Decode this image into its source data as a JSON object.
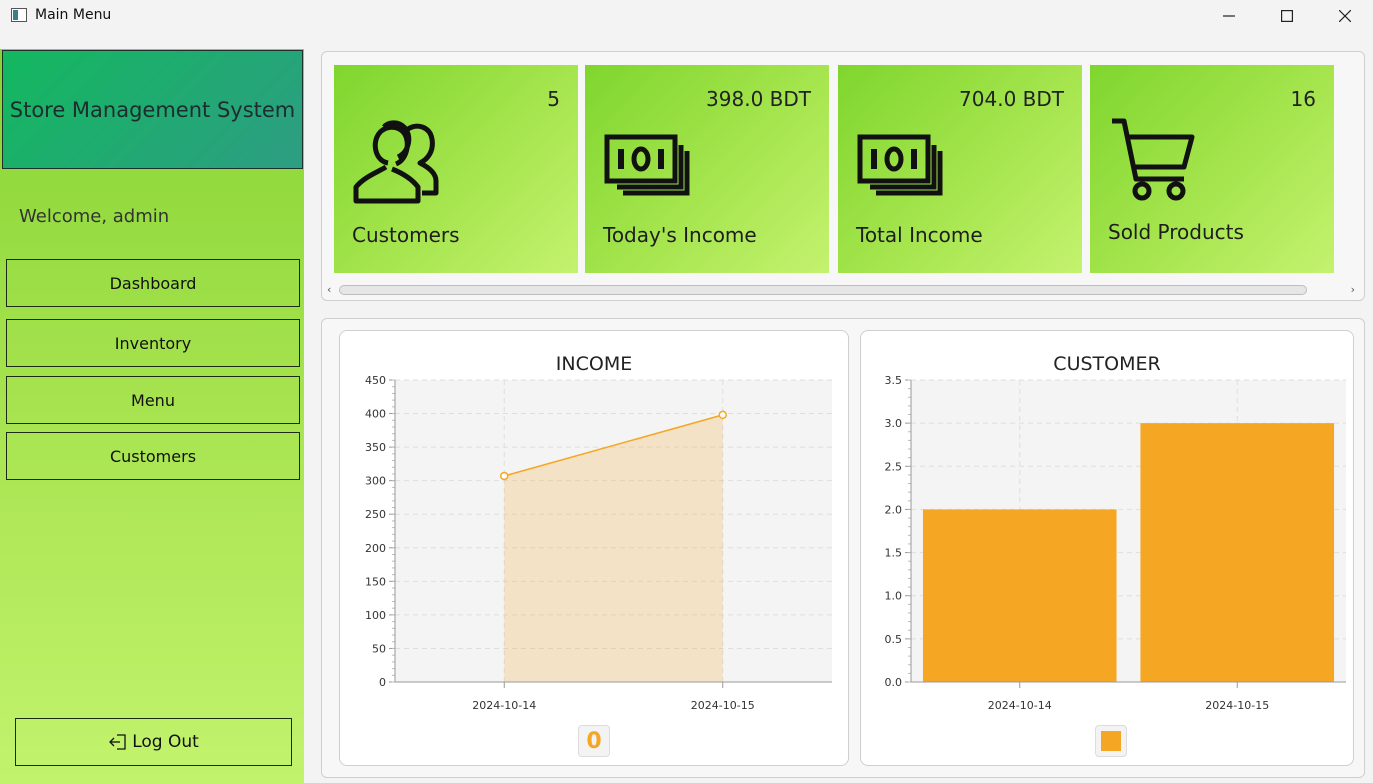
{
  "window": {
    "title": "Main Menu"
  },
  "sidebar": {
    "brand": "Store Management System",
    "welcome": "Welcome, admin",
    "nav": [
      {
        "label": "Dashboard"
      },
      {
        "label": "Inventory"
      },
      {
        "label": "Menu"
      },
      {
        "label": "Customers"
      }
    ],
    "logout_label": "Log Out"
  },
  "cards": [
    {
      "value": "5",
      "label": "Customers",
      "icon": "users-icon"
    },
    {
      "value": "398.0 BDT",
      "label": "Today's Income",
      "icon": "money-icon"
    },
    {
      "value": "704.0 BDT",
      "label": "Total Income",
      "icon": "money-icon"
    },
    {
      "value": "16",
      "label": "Sold Products",
      "icon": "cart-icon"
    }
  ],
  "colors": {
    "accent": "#f5a623",
    "sidebar_top": "#86d535",
    "brand": "#13b85f"
  },
  "chart_data": [
    {
      "type": "area",
      "title": "INCOME",
      "categories": [
        "2024-10-14",
        "2024-10-15"
      ],
      "values": [
        307,
        398
      ],
      "ylim": [
        0,
        450
      ],
      "yticks": [
        "0",
        "50",
        "100",
        "150",
        "200",
        "250",
        "300",
        "350",
        "400",
        "450"
      ],
      "grid": true,
      "legend": "bottom",
      "legend_label": "0"
    },
    {
      "type": "bar",
      "title": "CUSTOMER",
      "categories": [
        "2024-10-14",
        "2024-10-15"
      ],
      "values": [
        2,
        3
      ],
      "ylim": [
        0,
        3.5
      ],
      "yticks": [
        "0.0",
        "0.5",
        "1.0",
        "1.5",
        "2.0",
        "2.5",
        "3.0",
        "3.5"
      ],
      "grid": true,
      "legend": "bottom"
    }
  ]
}
